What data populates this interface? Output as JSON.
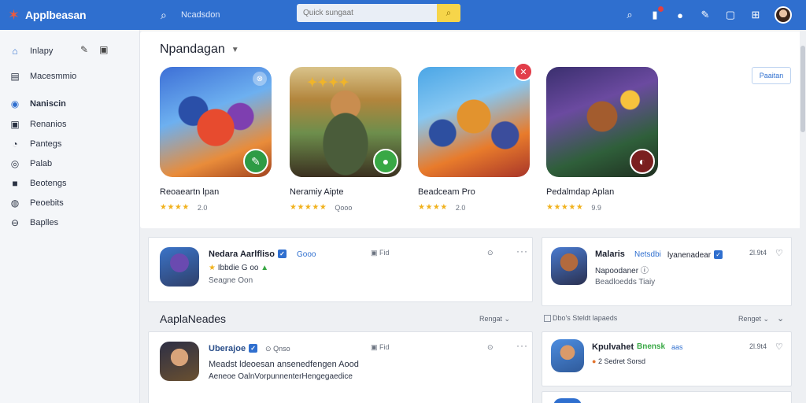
{
  "header": {
    "app_name": "Applbeasan",
    "search_label": "Ncadsdon",
    "search_placeholder": "Quick sungaat",
    "icons": [
      "search-icon",
      "bell-icon",
      "notification-icon",
      "pin-icon",
      "edit-icon",
      "info-icon",
      "grid-icon",
      "avatar"
    ]
  },
  "sidebar": {
    "items": [
      {
        "label": "Inlapy",
        "icon": "home-icon"
      },
      {
        "label": "Macesmmio",
        "icon": "list-icon"
      },
      {
        "label": "Naniscin",
        "icon": "compass-icon",
        "active": true
      },
      {
        "label": "Renanios",
        "icon": "camera-icon"
      },
      {
        "label": "Pantegs",
        "icon": "tag-icon"
      },
      {
        "label": "Palab",
        "icon": "circle-icon"
      },
      {
        "label": "Beotengs",
        "icon": "square-icon"
      },
      {
        "label": "Peoebits",
        "icon": "drop-icon"
      },
      {
        "label": "Baplles",
        "icon": "coin-icon"
      }
    ]
  },
  "featured": {
    "title": "Npandagan",
    "button": "Paaitan",
    "apps": [
      {
        "name": "Reoaeartn lpan",
        "rating": "2.0",
        "stars": 4
      },
      {
        "name": "Neramiy Aipte",
        "rating": "Qooo",
        "stars": 4
      },
      {
        "name": "Beadceam Pro",
        "rating": "2.0",
        "stars": 4
      },
      {
        "name": "Pedalmdap Aplan",
        "rating": "9.9",
        "stars": 4
      }
    ]
  },
  "posts": [
    {
      "name": "Nedara Aarlfliso",
      "tag": "Gooo",
      "action": "Fid",
      "line1": "Ibbdie G oo",
      "line2": "Seagne Oon"
    },
    {
      "name": "Uberajoe",
      "tag": "Qnso",
      "action": "Fid",
      "body1": "Meadst ldeoesan ansenedfengen Aood",
      "body2": "Aeneoe OalnVorpunnenterHengegaedice"
    }
  ],
  "side_posts": [
    {
      "name": "Malaris",
      "tag": "Netsdbi",
      "tag2": "lyanenadear",
      "time": "2l.9t4",
      "line1": "Napoodaner",
      "line2": "Beadloedds Tiaiy"
    },
    {
      "name": "Kpulvahet",
      "tag": "Bnensk",
      "tag2": "aas",
      "time": "2l.9t4",
      "line1": "2 Sedret Sorsd"
    }
  ],
  "section": {
    "title": "AaplaNeades",
    "filter": "Rengat",
    "checkbox": "Dbo's Steldt lapaeds",
    "filter2": "Renget"
  },
  "colors": {
    "brand": "#2f6fcf",
    "accent": "#f6d54a",
    "star": "#f1b21d"
  }
}
